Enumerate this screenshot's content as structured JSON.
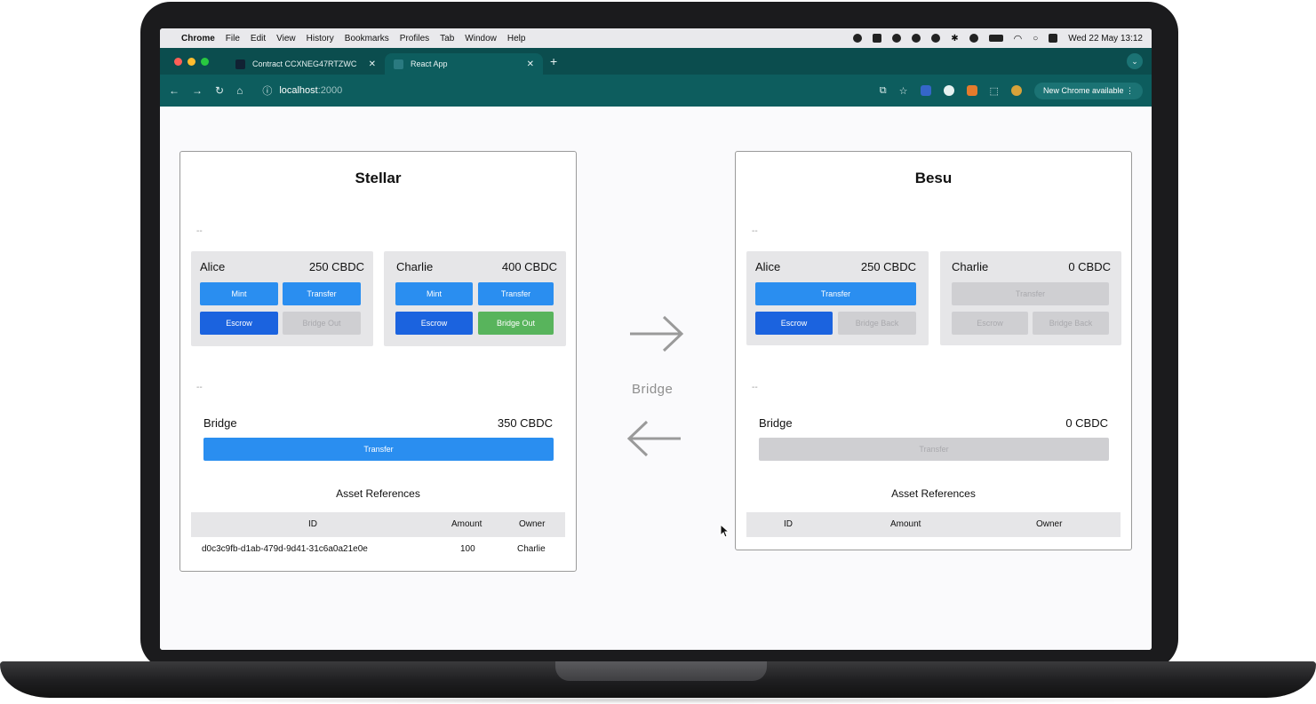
{
  "menubar": {
    "app": "Chrome",
    "items": [
      "File",
      "Edit",
      "View",
      "History",
      "Bookmarks",
      "Profiles",
      "Tab",
      "Window",
      "Help"
    ],
    "datetime": "Wed 22 May  13:12"
  },
  "browser": {
    "tabs": [
      {
        "label": "Contract CCXNEG47RTZWC",
        "active": false
      },
      {
        "label": "React App",
        "active": true
      }
    ],
    "url_host": "localhost",
    "url_port": ":2000",
    "update_label": "New Chrome available"
  },
  "stellar": {
    "title": "Stellar",
    "dash_top": "--",
    "accounts": [
      {
        "name": "Alice",
        "balance": "250 CBDC",
        "mint": "Mint",
        "transfer": "Transfer",
        "escrow": "Escrow",
        "bridge_out": "Bridge Out"
      },
      {
        "name": "Charlie",
        "balance": "400 CBDC",
        "mint": "Mint",
        "transfer": "Transfer",
        "escrow": "Escrow",
        "bridge_out": "Bridge Out"
      }
    ],
    "dash_bridge": "--",
    "bridge": {
      "name": "Bridge",
      "balance": "350 CBDC",
      "transfer": "Transfer"
    },
    "assets": {
      "title": "Asset References",
      "headers": [
        "ID",
        "Amount",
        "Owner"
      ],
      "rows": [
        {
          "id": "d0c3c9fb-d1ab-479d-9d41-31c6a0a21e0e",
          "amount": "100",
          "owner": "Charlie"
        }
      ]
    }
  },
  "middle": {
    "label": "Bridge"
  },
  "besu": {
    "title": "Besu",
    "dash_top": "--",
    "accounts": [
      {
        "name": "Alice",
        "balance": "250 CBDC",
        "transfer": "Transfer",
        "escrow": "Escrow",
        "bridge_back": "Bridge Back"
      },
      {
        "name": "Charlie",
        "balance": "0 CBDC",
        "transfer": "Transfer",
        "escrow": "Escrow",
        "bridge_back": "Bridge Back"
      }
    ],
    "dash_bridge": "--",
    "bridge": {
      "name": "Bridge",
      "balance": "0 CBDC",
      "transfer": "Transfer"
    },
    "assets": {
      "title": "Asset References",
      "headers": [
        "ID",
        "Amount",
        "Owner"
      ]
    }
  },
  "colors": {
    "chrome_theme": "#0d5d5e",
    "button_blue": "#2a8ef0",
    "button_dark_blue": "#1b63df",
    "button_green": "#58b45c",
    "button_disabled": "#cfcfd2"
  }
}
